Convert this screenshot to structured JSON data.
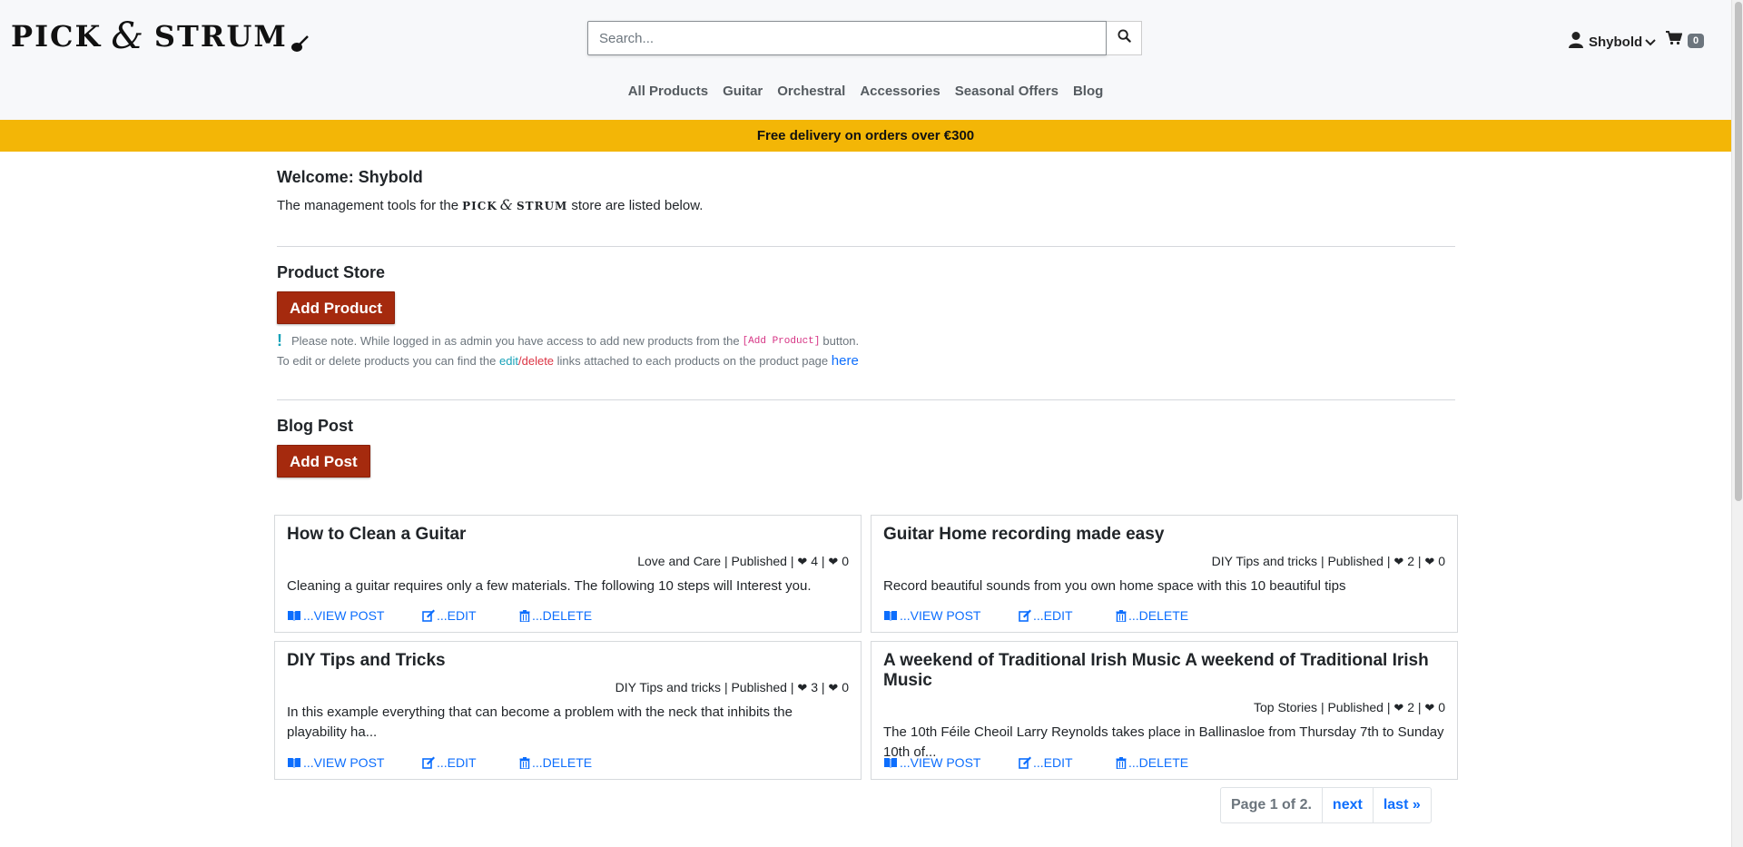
{
  "header": {
    "logo": {
      "word1": "PICK",
      "amp": "&",
      "word2": "STRUM"
    },
    "search": {
      "placeholder": "Search...",
      "value": ""
    },
    "user": {
      "name": "Shybold"
    },
    "cart": {
      "count": "0"
    }
  },
  "nav": {
    "items": [
      {
        "label": "All Products"
      },
      {
        "label": "Guitar"
      },
      {
        "label": "Orchestral"
      },
      {
        "label": "Accessories"
      },
      {
        "label": "Seasonal Offers"
      },
      {
        "label": "Blog"
      }
    ]
  },
  "banner": {
    "text": "Free delivery on orders over €300"
  },
  "management": {
    "welcome": "Welcome: Shybold",
    "intro_before": "The management tools for the",
    "intro_after": "store are listed below.",
    "product_store": {
      "title": "Product Store",
      "add_label": "Add Product",
      "note_line1_before": "Please note. While logged in as admin you have access to add new products from the",
      "note_code": "[Add Product]",
      "note_line1_after": "button.",
      "note_line2_before": "To edit or delete products you can find the",
      "note_edit": "edit",
      "note_slash": "/",
      "note_delete": "delete",
      "note_line2_after": "links attached to each products on the product page",
      "note_here": "here"
    },
    "blog": {
      "title": "Blog Post",
      "add_label": "Add Post"
    }
  },
  "posts": [
    {
      "title": "How to Clean a Guitar",
      "category": "Love and Care",
      "status": "Published",
      "likes": "4",
      "dislikes": "0",
      "excerpt": "Cleaning a guitar requires only a few materials. The following 10 steps will Interest you."
    },
    {
      "title": "Guitar Home recording made easy",
      "category": "DIY Tips and tricks",
      "status": "Published",
      "likes": "2",
      "dislikes": "0",
      "excerpt": "Record beautiful sounds from you own home space with this 10 beautiful tips"
    },
    {
      "title": "DIY Tips and Tricks",
      "category": "DIY Tips and tricks",
      "status": "Published",
      "likes": "3",
      "dislikes": "0",
      "excerpt": "In this example everything that can become a problem with the neck that inhibits the playability ha..."
    },
    {
      "title": "A weekend of Traditional Irish Music A weekend of Traditional Irish Music",
      "category": "Top Stories",
      "status": "Published",
      "likes": "2",
      "dislikes": "0",
      "excerpt": "The 10th Féile Cheoil Larry Reynolds takes place in Ballinasloe from Thursday 7th to Sunday 10th of..."
    }
  ],
  "post_actions": {
    "view": "...VIEW POST",
    "edit": "...EDIT",
    "delete": "...DELETE"
  },
  "meta_sep": "|",
  "pagination": {
    "current": "Page 1 of 2.",
    "next": "next",
    "last": "last »"
  },
  "colors": {
    "banner": "#f3b606",
    "button": "#a52a0e",
    "link": "#0d6efd",
    "header_bg": "#f7f8fa"
  },
  "icons": {
    "search": "search-icon",
    "user": "user-icon",
    "chevron": "chevron-down-icon",
    "cart": "cart-icon",
    "heart": "heart-icon",
    "book": "book-open-icon",
    "edit": "edit-icon",
    "trash": "trash-icon",
    "note": "exclamation-icon"
  }
}
